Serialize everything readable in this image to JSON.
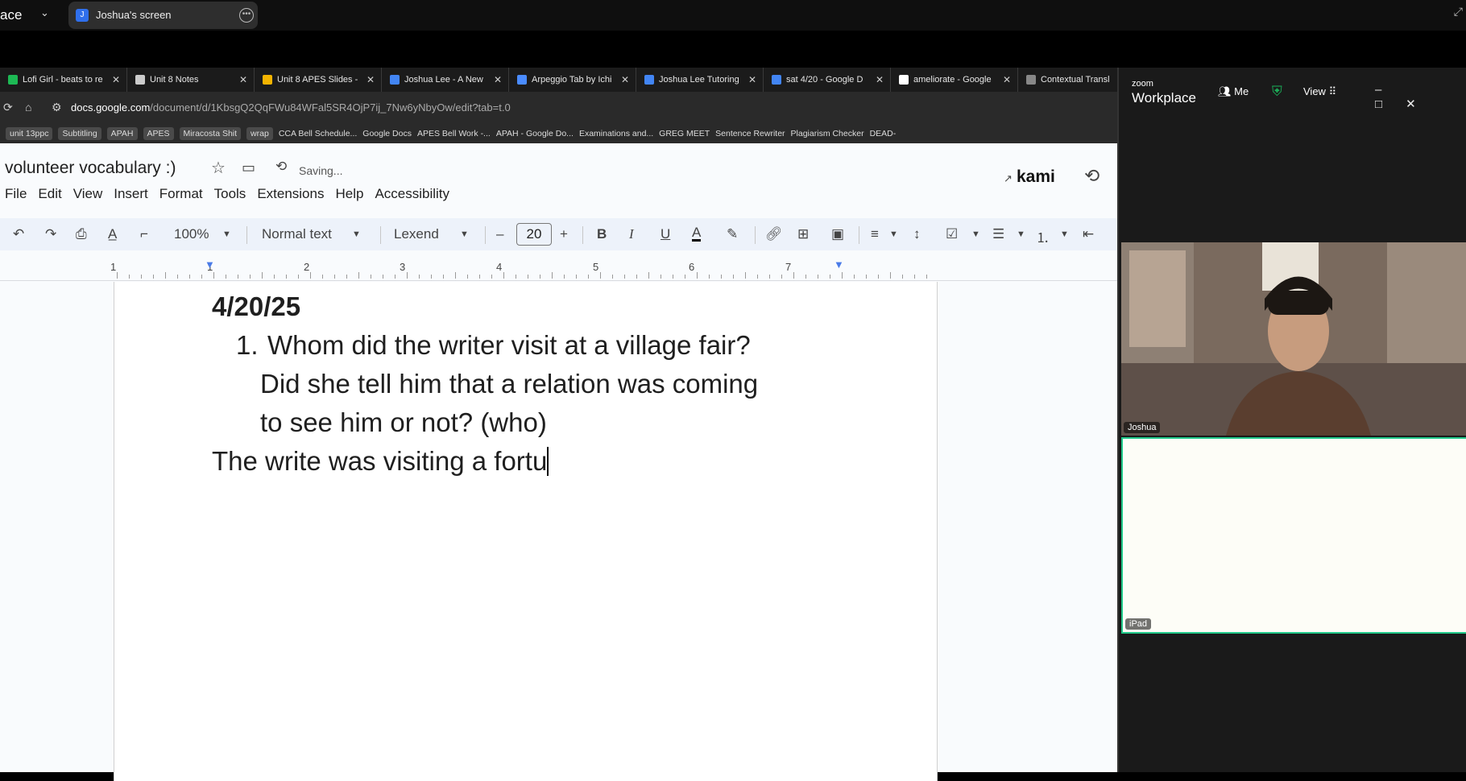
{
  "zoom_top": {
    "app_label": "ace",
    "share_name": "Joshua's screen",
    "share_initial": "J"
  },
  "browser": {
    "tabs": [
      {
        "label": "Lofi Girl - beats to re",
        "color": "#1db954"
      },
      {
        "label": "Unit 8 Notes",
        "color": "#cccccc"
      },
      {
        "label": "Unit 8 APES Slides -",
        "color": "#f4b400"
      },
      {
        "label": "Joshua Lee - A New",
        "color": "#4285f4"
      },
      {
        "label": "Arpeggio Tab by Ichi",
        "color": "#4a8cff"
      },
      {
        "label": "Joshua Lee Tutoring",
        "color": "#4285f4"
      },
      {
        "label": "sat 4/20 - Google D",
        "color": "#4285f4"
      },
      {
        "label": "ameliorate - Google",
        "color": "#ffffff"
      },
      {
        "label": "Contextual Transl",
        "color": "#888888"
      }
    ],
    "url_host": "docs.google.com",
    "url_path": "/document/d/1KbsgQ2QqFWu84WFal5SR4OjP7ij_7Nw6yNbyOw/edit?tab=t.0",
    "bookmarks": [
      "unit 13ppc",
      "Subtitling",
      "APAH",
      "APES",
      "Miracosta Shit",
      "wrap",
      "CCA Bell Schedule...",
      "Google Docs",
      "APES Bell Work -...",
      "APAH - Google Do...",
      "Examinations and...",
      "GREG MEET",
      "Sentence Rewriter",
      "Plagiarism Checker",
      "DEAD-"
    ]
  },
  "docs": {
    "title": "volunteer vocabulary :)",
    "status": "Saving...",
    "menu": [
      "File",
      "Edit",
      "View",
      "Insert",
      "Format",
      "Tools",
      "Extensions",
      "Help",
      "Accessibility"
    ],
    "kami": "kami",
    "zoom": "100%",
    "style": "Normal text",
    "font": "Lexend",
    "font_size": "20",
    "ruler_labels": [
      "1",
      "1",
      "2",
      "3",
      "4",
      "5",
      "6",
      "7"
    ],
    "content": {
      "date": "4/20/25",
      "item_number": "1.",
      "question_line1": "Whom did the writer visit at a village fair?",
      "question_line2": "Did she tell him that a relation was coming",
      "question_line3": "to see him or not? (who)",
      "answer": "The write was visiting a fortu"
    }
  },
  "zoom_panel": {
    "logo_small": "zoom",
    "logo_big": "Workplace",
    "meeting_label": "Me",
    "view_label": "View",
    "participants": [
      {
        "name": "Joshua"
      },
      {
        "name": "iPad"
      }
    ]
  },
  "colors": {
    "speaker_border": "#21c98a",
    "docs_bg": "#f9fbfd",
    "toolbar_bg": "#edf2fa"
  }
}
